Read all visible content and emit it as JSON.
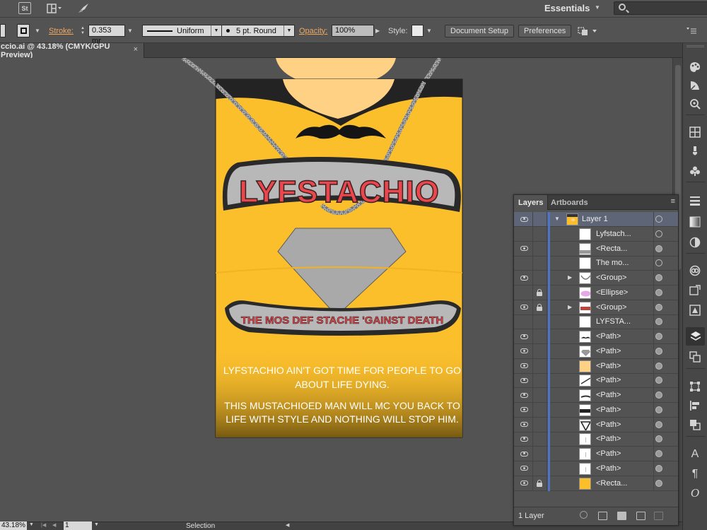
{
  "appbar": {
    "stock_label": "St",
    "workspace_label": "Essentials",
    "search_placeholder": ""
  },
  "controlbar": {
    "stroke_label": "Stroke:",
    "stroke_value": "0.353 mr",
    "profile_value": "Uniform",
    "brush_value": "5 pt. Round",
    "opacity_label": "Opacity:",
    "opacity_value": "100%",
    "style_label": "Style:",
    "doc_setup_label": "Document Setup",
    "preferences_label": "Preferences"
  },
  "document": {
    "tab_title": "ccio.ai @ 43.18% (CMYK/GPU Preview)",
    "close_glyph": "×"
  },
  "artwork": {
    "title": "LYFSTACHIO",
    "tagline": "THE MOS DEF STACHE 'GAINST DEATH",
    "body_line1": "LYFSTACHIO AIN'T GOT TIME FOR PEOPLE TO GO",
    "body_line2": "ABOUT LIFE DYING.",
    "body_line3": "THIS MUSTACHIOED MAN WILL MC YOU BACK TO",
    "body_line4": "LIFE WITH STYLE AND NOTHING WILL STOP HIM.",
    "colors": {
      "background": "#fbbf2c",
      "title_red": "#e8474d",
      "plate_gray": "#a9a9a9"
    }
  },
  "statusbar": {
    "zoom_value": "43.18%",
    "artboard_value": "1",
    "tool_label": "Selection"
  },
  "layers_panel": {
    "tab_layers": "Layers",
    "tab_artboards": "Artboards",
    "footer_count": "1 Layer",
    "rows": [
      {
        "name": "Layer 1",
        "eye": true,
        "lock": false,
        "expander": "▼",
        "target": "hollow",
        "thumb": "layer"
      },
      {
        "name": "Lyfstach...",
        "eye": false,
        "lock": false,
        "expander": "",
        "target": "hollow",
        "thumb": "blank"
      },
      {
        "name": "<Recta...",
        "eye": true,
        "lock": false,
        "expander": "",
        "target": "filled",
        "thumb": "gradient"
      },
      {
        "name": "The mo...",
        "eye": false,
        "lock": false,
        "expander": "",
        "target": "hollow",
        "thumb": "blank"
      },
      {
        "name": "<Group>",
        "eye": true,
        "lock": false,
        "expander": "▶",
        "target": "filled",
        "thumb": "chain"
      },
      {
        "name": "<Ellipse>",
        "eye": false,
        "lock": true,
        "expander": "",
        "target": "filled",
        "thumb": "ellipse"
      },
      {
        "name": "<Group>",
        "eye": true,
        "lock": true,
        "expander": "▶",
        "target": "filled",
        "thumb": "banner"
      },
      {
        "name": "LYFSTA...",
        "eye": false,
        "lock": false,
        "expander": "",
        "target": "filled",
        "thumb": "blank"
      },
      {
        "name": "<Path>",
        "eye": true,
        "lock": false,
        "expander": "",
        "target": "filled",
        "thumb": "stache"
      },
      {
        "name": "<Path>",
        "eye": true,
        "lock": false,
        "expander": "",
        "target": "filled",
        "thumb": "diamond"
      },
      {
        "name": "<Path>",
        "eye": true,
        "lock": false,
        "expander": "",
        "target": "filled",
        "thumb": "skin"
      },
      {
        "name": "<Path>",
        "eye": true,
        "lock": false,
        "expander": "",
        "target": "filled",
        "thumb": "line"
      },
      {
        "name": "<Path>",
        "eye": true,
        "lock": false,
        "expander": "",
        "target": "filled",
        "thumb": "line2"
      },
      {
        "name": "<Path>",
        "eye": true,
        "lock": false,
        "expander": "",
        "target": "filled",
        "thumb": "band"
      },
      {
        "name": "<Path>",
        "eye": true,
        "lock": false,
        "expander": "",
        "target": "filled",
        "thumb": "vshape"
      },
      {
        "name": "<Path>",
        "eye": true,
        "lock": false,
        "expander": "",
        "target": "filled",
        "thumb": "tick"
      },
      {
        "name": "<Path>",
        "eye": true,
        "lock": false,
        "expander": "",
        "target": "filled",
        "thumb": "tick"
      },
      {
        "name": "<Path>",
        "eye": true,
        "lock": false,
        "expander": "",
        "target": "filled",
        "thumb": "tick"
      },
      {
        "name": "<Recta...",
        "eye": true,
        "lock": true,
        "expander": "",
        "target": "filled",
        "thumb": "yellow"
      }
    ]
  }
}
